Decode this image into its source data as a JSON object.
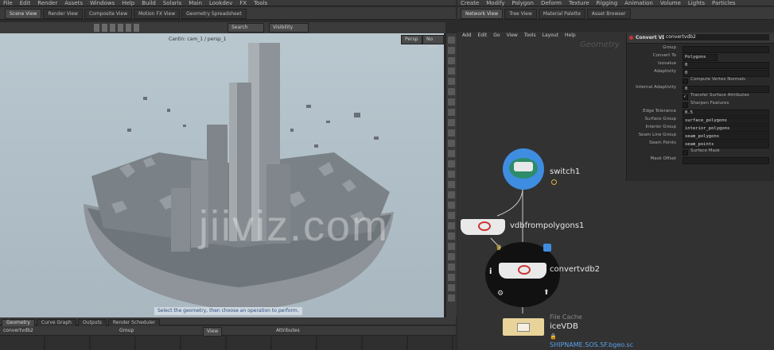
{
  "top_menu": [
    "File",
    "Edit",
    "Render",
    "Assets",
    "Windows",
    "Help",
    "Build",
    "Solaris",
    "Main",
    "Lookdev",
    "FX",
    "Tools"
  ],
  "top_right_menu": [
    "Create",
    "Modify",
    "Polygon",
    "Deform",
    "Texture",
    "Rigging",
    "Animation",
    "Volume",
    "Lights",
    "Particles"
  ],
  "viewer_tabs": [
    "Scene View",
    "Render View",
    "Composite View",
    "Motion FX View",
    "Geometry Spreadsheet"
  ],
  "network_tabs": [
    "Network View",
    "Tree View",
    "Material Palette",
    "Asset Browser"
  ],
  "viewport": {
    "top_label": "Cantin: cam_1 / persp_1",
    "persp_button": "Persp",
    "camera_button": "No cam",
    "search_placeholder": "Search",
    "visibility_label": "Visibility",
    "status_message": "Select the geometry, then choose an operation to perform.",
    "watermark": "jiiviz.com"
  },
  "network_menu": [
    "Add",
    "Edit",
    "Go",
    "View",
    "Tools",
    "Layout",
    "Help"
  ],
  "network_context": "Geometry",
  "nodes": [
    {
      "name": "switch1"
    },
    {
      "name": "vdbfrompolygons1"
    },
    {
      "name": "convertvdb2"
    },
    {
      "name": "iceVDB",
      "type_label": "File Cache",
      "path": "SHIPNAME.SOS.SF.bgeo.sc"
    }
  ],
  "params": {
    "node_type": "Convert VDB",
    "node_name": "convertvdb2",
    "rows": [
      {
        "label": "Group",
        "value": ""
      },
      {
        "label": "Convert To",
        "value": "Polygons"
      },
      {
        "label": "Isovalue",
        "value": "0"
      },
      {
        "label": "Adaptivity",
        "value": "0"
      },
      {
        "label": "",
        "check": "Compute Vertex Normals"
      },
      {
        "label": "Internal Adaptivity",
        "value": "0"
      },
      {
        "label": "",
        "check": "Transfer Surface Attributes"
      },
      {
        "label": "",
        "check": "Sharpen Features"
      },
      {
        "label": "Edge Tolerance",
        "value": "0.5"
      },
      {
        "label": "Surface Group",
        "value": "surface_polygons"
      },
      {
        "label": "Interior Group",
        "value": "interior_polygons"
      },
      {
        "label": "Seam Line Group",
        "value": "seam_polygons"
      },
      {
        "label": "Seam Points",
        "value": "seam_points"
      },
      {
        "label": "",
        "check": "Surface Mask"
      },
      {
        "label": "Mask Offset",
        "value": ""
      }
    ]
  },
  "bottom": {
    "tabs": [
      "Geometry",
      "Curve Graph",
      "Outputs",
      "Render Scheduler"
    ],
    "node_name": "convertvdb2",
    "group_label": "Group",
    "view_label": "View",
    "attributes_label": "Attributes"
  },
  "colors": {
    "bg": "#2b2b2b",
    "viewport_sky": "#b2c1ca",
    "network_bg": "#323232",
    "accent_blue": "#3f8de0",
    "wire": "#c9c9c9",
    "cache_node": "#e8d39a"
  }
}
